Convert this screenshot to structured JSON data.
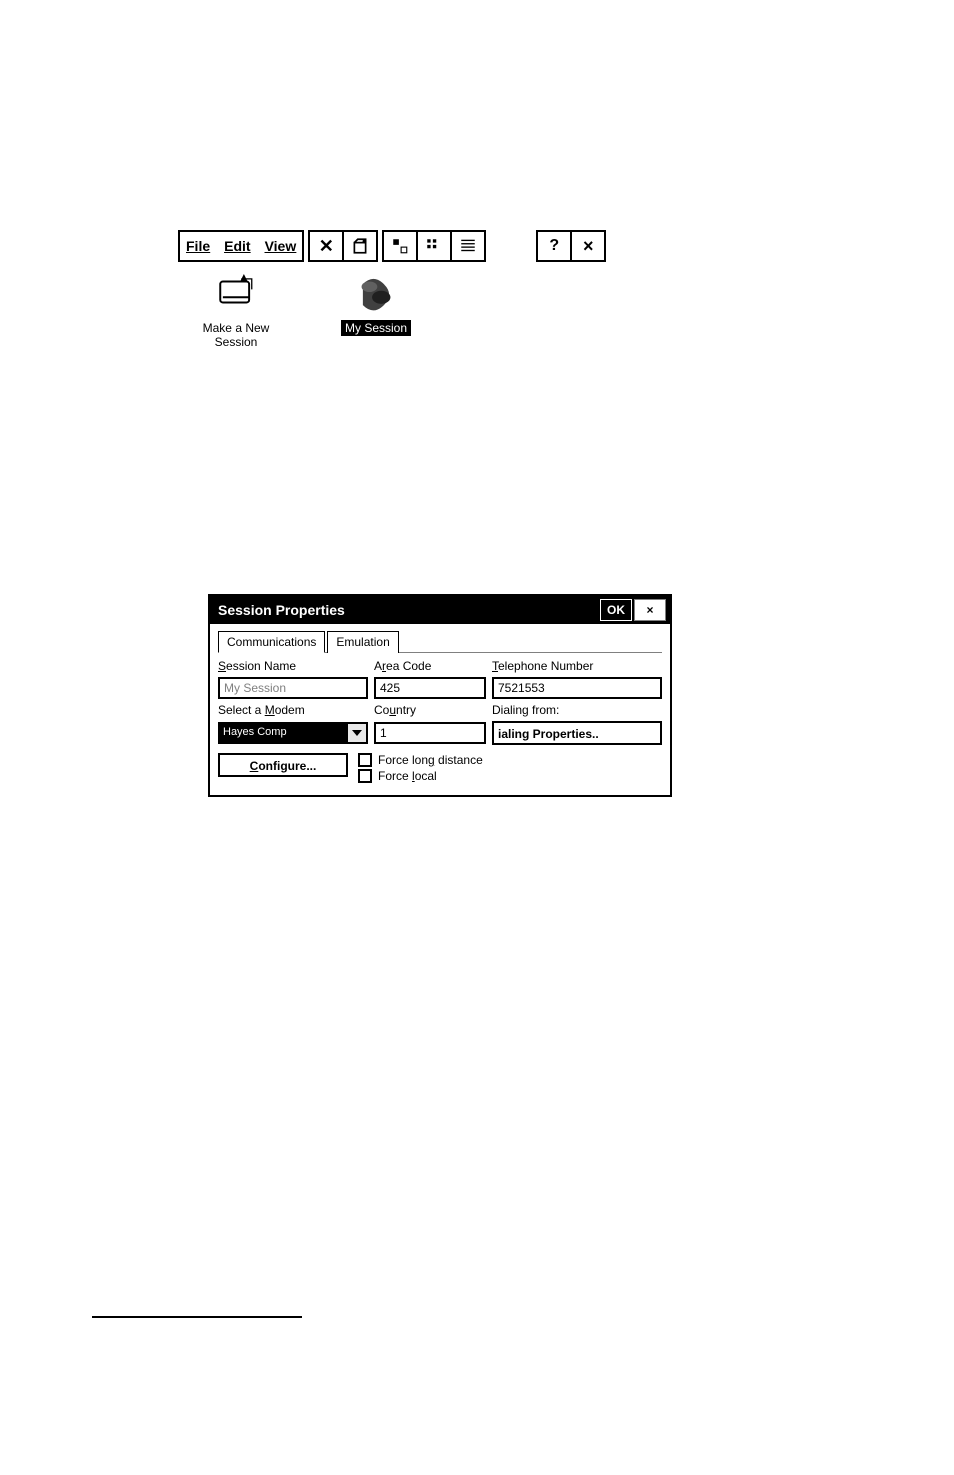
{
  "menus": {
    "file": "File",
    "edit": "Edit",
    "view": "View"
  },
  "icons": {
    "new_session": "Make a New Session",
    "my_session": "My Session"
  },
  "dialog": {
    "title": "Session Properties",
    "ok": "OK",
    "close": "×",
    "tabs": {
      "communications": "Communications",
      "emulation": "Emulation"
    },
    "labels": {
      "session_name": "Session Name",
      "area_code": "Area Code",
      "telephone": "Telephone Number",
      "select_modem": "Select a Modem",
      "country": "Country",
      "dialing_from": "Dialing from:"
    },
    "values": {
      "session_name": "My Session",
      "area_code": "425",
      "telephone": "7521553",
      "modem": "Hayes Comp",
      "country": "1"
    },
    "buttons": {
      "dialing_properties": "ialing Properties..",
      "configure": "Configure..."
    },
    "checks": {
      "force_long": "Force long distance",
      "force_local": "Force local"
    }
  },
  "toolbar_help": "?",
  "toolbar_close": "×"
}
